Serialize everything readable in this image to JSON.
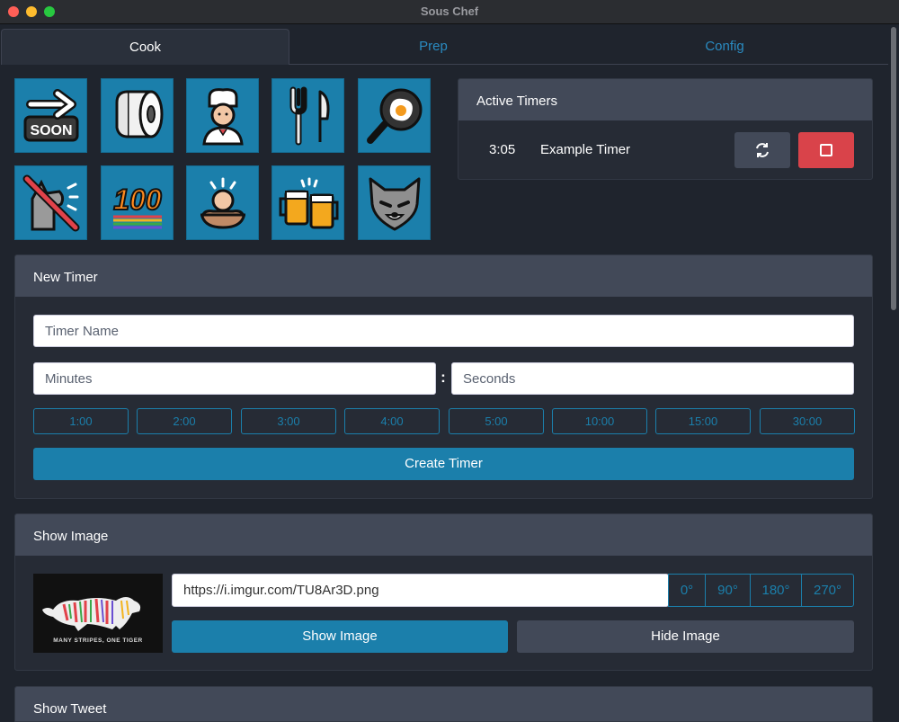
{
  "window": {
    "title": "Sous Chef"
  },
  "tabs": [
    {
      "label": "Cook",
      "active": true
    },
    {
      "label": "Prep",
      "active": false
    },
    {
      "label": "Config",
      "active": false
    }
  ],
  "emoji_buttons": [
    {
      "icon": "soon-arrow-icon"
    },
    {
      "icon": "toilet-paper-icon"
    },
    {
      "icon": "cook-icon"
    },
    {
      "icon": "fork-and-knife-icon"
    },
    {
      "icon": "cooking-pan-egg-icon"
    },
    {
      "icon": "no-wolf-howl-icon"
    },
    {
      "icon": "rainbow-100-icon"
    },
    {
      "icon": "person-in-bath-icon"
    },
    {
      "icon": "clinking-beer-mugs-icon"
    },
    {
      "icon": "wolf-face-icon"
    }
  ],
  "active_timers": {
    "title": "Active Timers",
    "timers": [
      {
        "time": "3:05",
        "name": "Example Timer"
      }
    ],
    "restart_icon": "refresh-icon",
    "stop_icon": "stop-icon",
    "stop_color": "#d9434a"
  },
  "new_timer": {
    "title": "New Timer",
    "name_placeholder": "Timer Name",
    "minutes_placeholder": "Minutes",
    "separator": ":",
    "seconds_placeholder": "Seconds",
    "presets": [
      "1:00",
      "2:00",
      "3:00",
      "4:00",
      "5:00",
      "10:00",
      "15:00",
      "30:00"
    ],
    "create_label": "Create Timer"
  },
  "show_image": {
    "title": "Show Image",
    "preview_caption": "MANY STRIPES, ONE TIGER",
    "url_value": "https://i.imgur.com/TU8Ar3D.png",
    "rotations": [
      "0°",
      "90°",
      "180°",
      "270°"
    ],
    "show_label": "Show Image",
    "hide_label": "Hide Image"
  },
  "show_tweet": {
    "title": "Show Tweet"
  },
  "colors": {
    "accent": "#1b7fab",
    "panel_header": "#424958",
    "background": "#1f242d",
    "danger": "#d9434a"
  }
}
